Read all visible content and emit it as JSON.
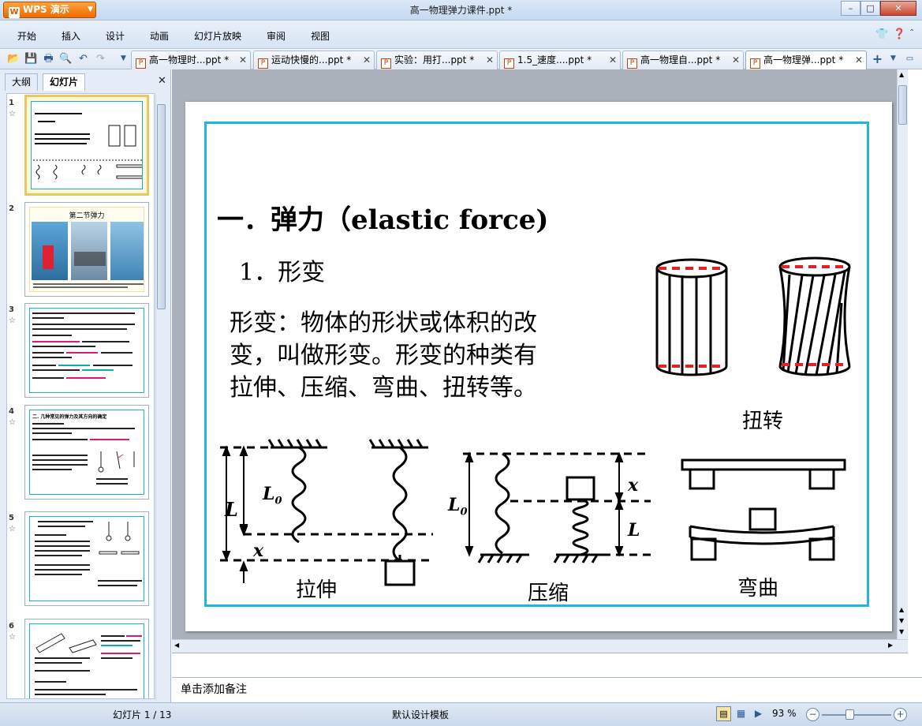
{
  "window": {
    "title": "高一物理弹力课件.ppt *",
    "app_button": "WPS 演示",
    "app_logo": "W",
    "min": "–",
    "max": "□",
    "close": "✕"
  },
  "menu": {
    "items": [
      "开始",
      "插入",
      "设计",
      "动画",
      "幻灯片放映",
      "审阅",
      "视图"
    ]
  },
  "tabs": [
    {
      "label": "高一物理时...ppt *"
    },
    {
      "label": "运动快慢的...ppt *"
    },
    {
      "label": "实验：用打...ppt *"
    },
    {
      "label": "1.5_速度....ppt *"
    },
    {
      "label": "高一物理自...ppt *"
    },
    {
      "label": "高一物理弹...ppt *",
      "active": true
    }
  ],
  "tab_new": "+",
  "left_panel": {
    "tab_outline": "大纲",
    "tab_slides": "幻灯片",
    "close": "✕"
  },
  "thumbnails": [
    {
      "num": "1",
      "selected": true
    },
    {
      "num": "2",
      "title": "第二节弹力"
    },
    {
      "num": "3"
    },
    {
      "num": "4",
      "title": "二. 几种常见的弹力及其方向的确定"
    },
    {
      "num": "5"
    },
    {
      "num": "6"
    }
  ],
  "slide": {
    "title": "一．弹力（elastic force)",
    "subtitle": "1．形变",
    "body_lines": [
      "形变：物体的形状或体积的改",
      "变，叫做形变。形变的种类有",
      "拉伸、压缩、弯曲、扭转等。"
    ],
    "label_twist": "扭转",
    "label_stretch": "拉伸",
    "label_compress": "压缩",
    "label_bend": "弯曲",
    "sym_L": "L",
    "sym_L0": "L",
    "sym_L0_sub": "0",
    "sym_x": "x"
  },
  "notes": {
    "placeholder": "单击添加备注"
  },
  "status": {
    "slide_counter": "幻灯片 1 / 13",
    "template": "默认设计模板",
    "zoom": "93 %",
    "zoom_out": "−",
    "zoom_in": "+"
  },
  "colors": {
    "accent_frame": "#20b5e3",
    "dash_red": "#e52222",
    "wps_orange": "#f07d10"
  }
}
